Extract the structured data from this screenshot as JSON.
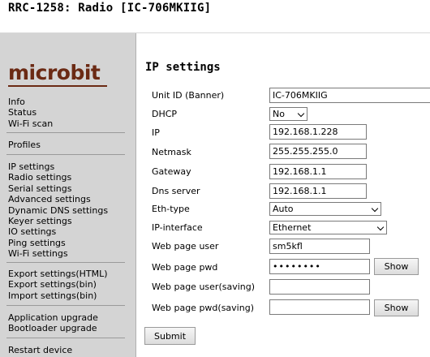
{
  "page": {
    "title": "RRC-1258: Radio [IC-706MKIIG]"
  },
  "brand": {
    "logo_text": "microbit",
    "logo_color": "#6b2a14"
  },
  "sidebar": {
    "groups": [
      [
        "Info",
        "Status",
        "Wi-Fi scan"
      ],
      [
        "Profiles"
      ],
      [
        "IP settings",
        "Radio settings",
        "Serial settings",
        "Advanced settings",
        "Dynamic DNS settings",
        "Keyer settings",
        "IO settings",
        "Ping settings",
        "Wi-Fi settings"
      ],
      [
        "Export settings(HTML)",
        "Export settings(bin)",
        "Import settings(bin)"
      ],
      [
        "Application upgrade",
        "Bootloader upgrade"
      ],
      [
        "Restart device"
      ]
    ]
  },
  "form": {
    "section_title": "IP settings",
    "unit_id": {
      "label": "Unit ID (Banner)",
      "value": "IC-706MKIIG"
    },
    "dhcp": {
      "label": "DHCP",
      "value": "No"
    },
    "ip": {
      "label": "IP",
      "value": "192.168.1.228"
    },
    "netmask": {
      "label": "Netmask",
      "value": "255.255.255.0"
    },
    "gateway": {
      "label": "Gateway",
      "value": "192.168.1.1"
    },
    "dns": {
      "label": "Dns server",
      "value": "192.168.1.1"
    },
    "eth_type": {
      "label": "Eth-type",
      "value": "Auto"
    },
    "ip_interface": {
      "label": "IP-interface",
      "value": "Ethernet"
    },
    "web_user": {
      "label": "Web page user",
      "value": "sm5kfl"
    },
    "web_pwd": {
      "label": "Web page pwd",
      "value": "••••••••",
      "show_label": "Show"
    },
    "web_user_saving": {
      "label": "Web page user(saving)",
      "value": ""
    },
    "web_pwd_saving": {
      "label": "Web page pwd(saving)",
      "value": "",
      "show_label": "Show"
    },
    "submit_label": "Submit"
  }
}
